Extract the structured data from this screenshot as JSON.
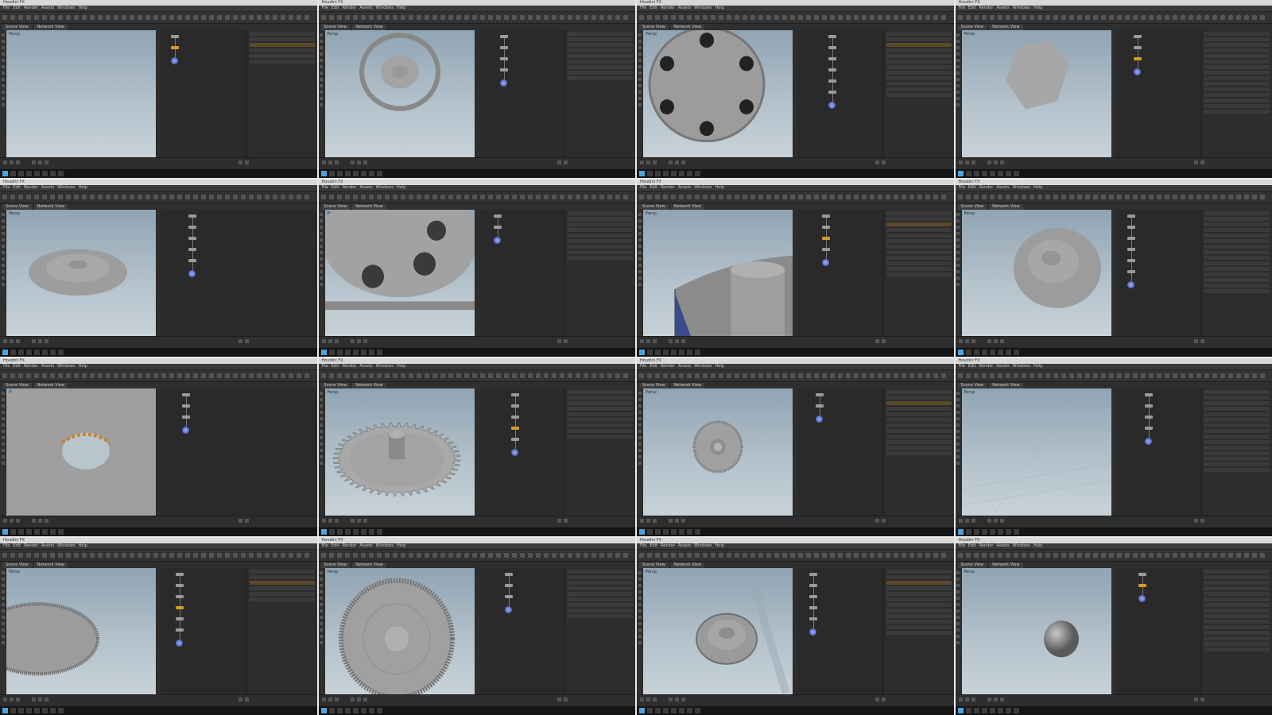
{
  "app": {
    "window_title": "Houdini FX",
    "menu_items": [
      "File",
      "Edit",
      "Render",
      "Assets",
      "Windows",
      "Help"
    ],
    "tabs": [
      "Scene View",
      "Network View"
    ],
    "viewport_label": "Persp"
  },
  "tiles": [
    {
      "id": 1,
      "viewport_content": "empty"
    },
    {
      "id": 2,
      "viewport_content": "ring-disc"
    },
    {
      "id": 3,
      "viewport_content": "wheel-with-holes"
    },
    {
      "id": 4,
      "viewport_content": "hexagon"
    },
    {
      "id": 5,
      "viewport_content": "flat-disc"
    },
    {
      "id": 6,
      "viewport_content": "gear-closeup-holes"
    },
    {
      "id": 7,
      "viewport_content": "cylinder-closeup"
    },
    {
      "id": 8,
      "viewport_content": "flat-disc-angled"
    },
    {
      "id": 9,
      "viewport_content": "ring-closeup"
    },
    {
      "id": 10,
      "viewport_content": "gear-with-hub"
    },
    {
      "id": 11,
      "viewport_content": "small-gear-top"
    },
    {
      "id": 12,
      "viewport_content": "empty-grid"
    },
    {
      "id": 13,
      "viewport_content": "disc-edge"
    },
    {
      "id": 14,
      "viewport_content": "gear-top-view"
    },
    {
      "id": 15,
      "viewport_content": "stacked-gear"
    },
    {
      "id": 16,
      "viewport_content": "sphere"
    }
  ],
  "colors": {
    "viewport_top": "#90a4b3",
    "viewport_bottom": "#c8d2d8",
    "ui_dark": "#2b2b2b",
    "node_default": "#9a9a9a",
    "node_selected": "#d49a2a",
    "node_output": "#5a6cc8"
  }
}
